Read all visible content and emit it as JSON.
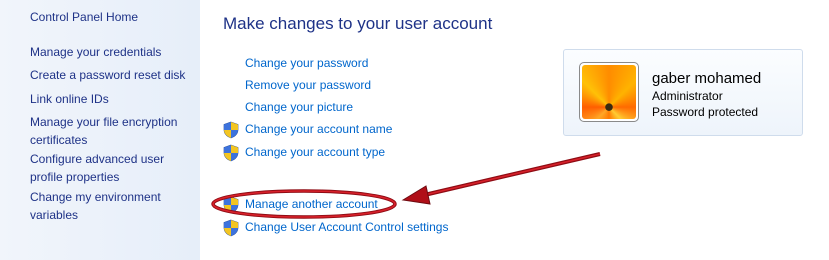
{
  "sidebar": {
    "home": "Control Panel Home",
    "items": [
      {
        "label": "Manage your credentials"
      },
      {
        "label": "Create a password reset disk"
      },
      {
        "label": "Link online IDs"
      },
      {
        "label": "Manage your file encryption certificates"
      },
      {
        "label": "Configure advanced user profile properties"
      },
      {
        "label": "Change my environment variables"
      }
    ]
  },
  "main": {
    "title": "Make changes to your user account",
    "tasks": [
      {
        "label": "Change your password",
        "shield": false
      },
      {
        "label": "Remove your password",
        "shield": false
      },
      {
        "label": "Change your picture",
        "shield": false
      },
      {
        "label": "Change your account name",
        "shield": true
      },
      {
        "label": "Change your account type",
        "shield": true
      }
    ],
    "other_tasks": [
      {
        "label": "Manage another account",
        "shield": true,
        "highlighted": true
      },
      {
        "label": "Change User Account Control settings",
        "shield": true
      }
    ]
  },
  "account": {
    "name": "gaber mohamed",
    "role": "Administrator",
    "status": "Password protected"
  },
  "colors": {
    "link": "#0066cc",
    "heading": "#1e3287",
    "annotation": "#c0101a"
  }
}
